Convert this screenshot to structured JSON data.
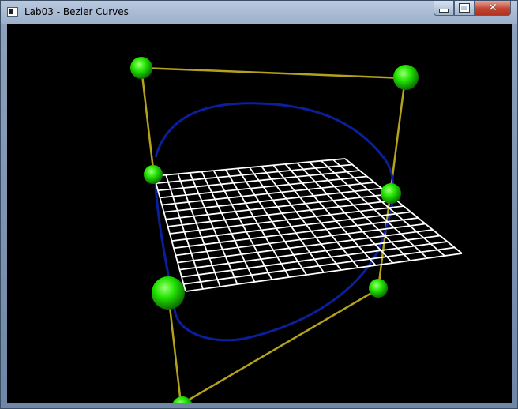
{
  "window": {
    "title": "Lab03 - Bezier Curves",
    "controls": {
      "minimize": "minimize",
      "maximize": "maximize",
      "close": "✕"
    }
  },
  "scene": {
    "background_color": "#000000",
    "control_point_color": "#22e600",
    "control_polygon_color": "#b5a21c",
    "curve_color": "#0b1f9c",
    "grid_color": "#ffffff"
  }
}
